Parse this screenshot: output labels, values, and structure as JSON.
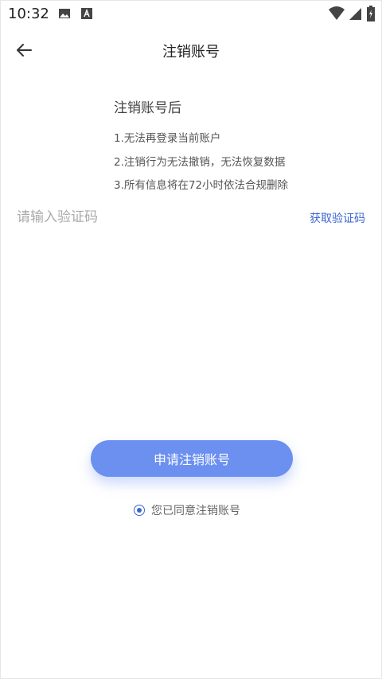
{
  "status_bar": {
    "time": "10:32",
    "left_icons": [
      "image-icon",
      "font-icon"
    ],
    "right_icons": [
      "wifi-icon",
      "signal-icon",
      "battery-icon"
    ]
  },
  "header": {
    "title": "注销账号",
    "back_icon": "back-arrow-icon"
  },
  "notice": {
    "heading": "注销账号后",
    "items": [
      "1.无法再登录当前账户",
      "2.注销行为无法撤销，无法恢复数据",
      "3.所有信息将在72小时依法合规删除"
    ]
  },
  "verification": {
    "placeholder": "请输入验证码",
    "value": "",
    "get_code_label": "获取验证码"
  },
  "actions": {
    "submit_label": "申请注销账号",
    "agree_label": "您已同意注销账号",
    "agree_checked": true
  },
  "colors": {
    "accent": "#3a66d0",
    "button": "#6b90f0",
    "text": "#333333",
    "placeholder": "#aaaaaa"
  }
}
